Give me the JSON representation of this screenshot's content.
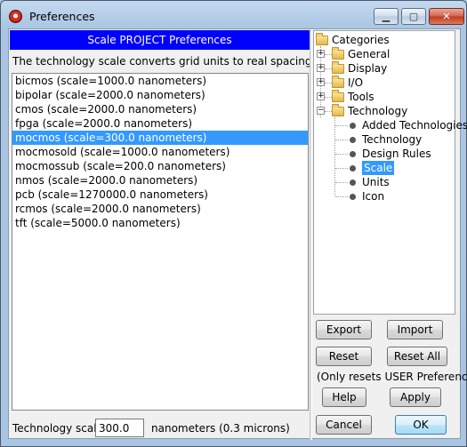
{
  "window": {
    "title": "Preferences"
  },
  "titlebar_buttons": {
    "minimize": "▁",
    "maximize": "▢",
    "close": "✕"
  },
  "panel": {
    "header": "Scale PROJECT Preferences",
    "description": "The technology scale converts grid units to real spacing on the chip:"
  },
  "tech_list": [
    {
      "label": "bicmos (scale=1000.0 nanometers)",
      "selected": false
    },
    {
      "label": "bipolar (scale=2000.0 nanometers)",
      "selected": false
    },
    {
      "label": "cmos (scale=2000.0 nanometers)",
      "selected": false
    },
    {
      "label": "fpga (scale=2000.0 nanometers)",
      "selected": false
    },
    {
      "label": "mocmos (scale=300.0 nanometers)",
      "selected": true
    },
    {
      "label": "mocmosold (scale=1000.0 nanometers)",
      "selected": false
    },
    {
      "label": "mocmossub (scale=200.0 nanometers)",
      "selected": false
    },
    {
      "label": "nmos (scale=2000.0 nanometers)",
      "selected": false
    },
    {
      "label": "pcb (scale=1270000.0 nanometers)",
      "selected": false
    },
    {
      "label": "rcmos (scale=2000.0 nanometers)",
      "selected": false
    },
    {
      "label": "tft (scale=5000.0 nanometers)",
      "selected": false
    }
  ],
  "scale": {
    "label": "Technology scale:",
    "value": "300.0",
    "unit": "nanometers (0.3 microns)"
  },
  "tree": {
    "root": "Categories",
    "folders": [
      "General",
      "Display",
      "I/O",
      "Tools",
      "Technology"
    ],
    "expand_collapsed": "+",
    "expand_open": "−",
    "technology_children": [
      "Added Technologies",
      "Technology",
      "Design Rules",
      "Scale",
      "Units",
      "Icon"
    ],
    "selected": "Scale"
  },
  "buttons": {
    "export": "Export",
    "import": "Import",
    "reset": "Reset",
    "reset_all": "Reset All",
    "reset_note": "(Only resets USER Preferences)",
    "help": "Help",
    "apply": "Apply",
    "cancel": "Cancel",
    "ok": "OK"
  }
}
